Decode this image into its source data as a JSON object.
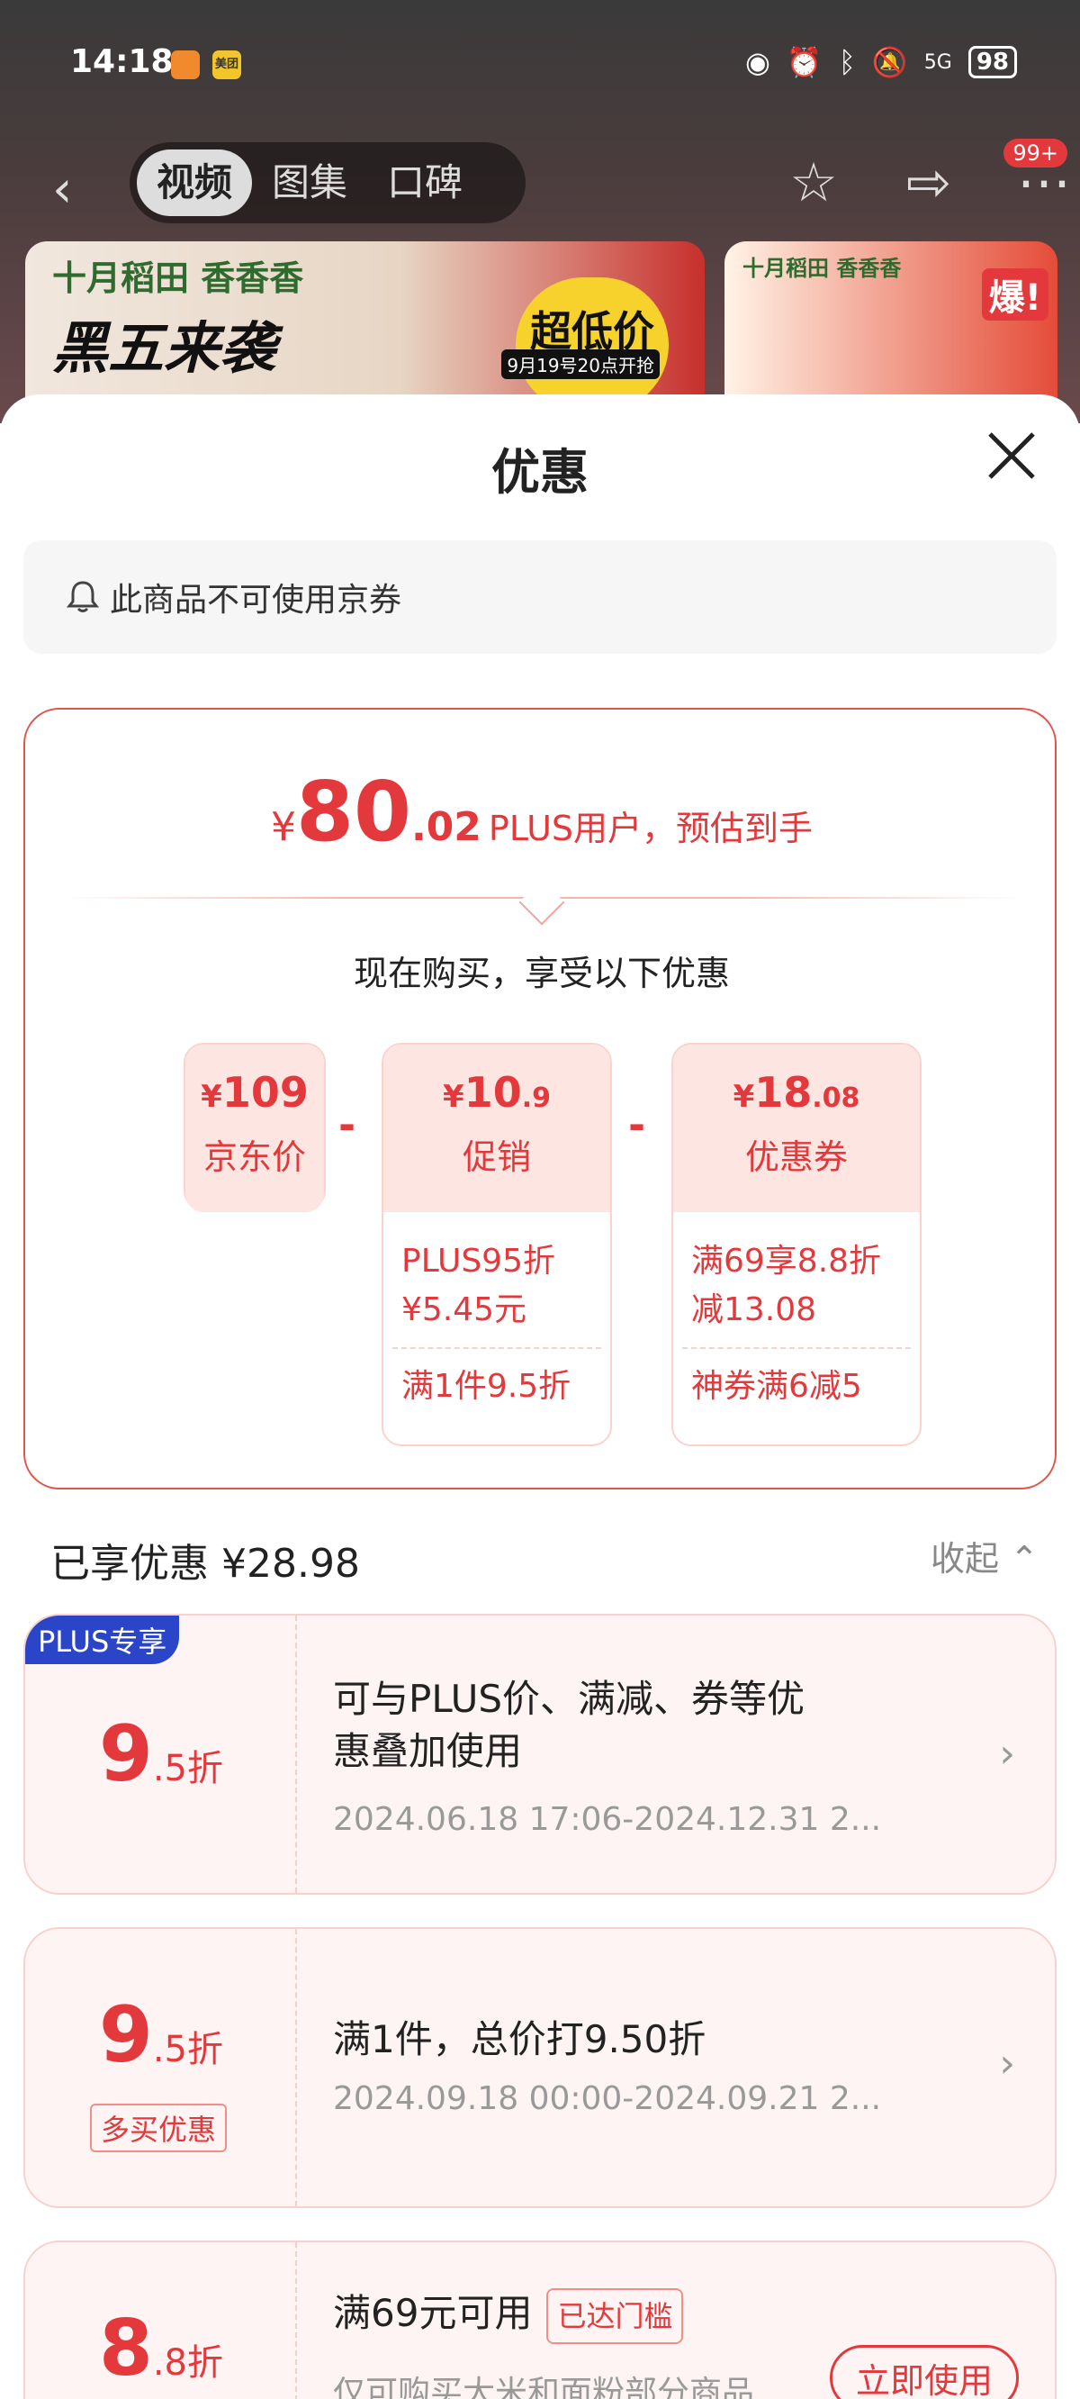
{
  "status_bar": {
    "time": "14:18",
    "app_badge": "美团",
    "battery": "98",
    "network": "5G"
  },
  "nav": {
    "tabs": [
      "视频",
      "图集",
      "口碑"
    ],
    "active_tab": 0,
    "cart_badge": "99+"
  },
  "ads": {
    "brand": "十月稻田 香香香",
    "slogan": "黑五来袭",
    "promo": "超低价",
    "promo_date": "9月19号20点开抢",
    "side_brand": "十月稻田 香香香",
    "side_tag": "爆!"
  },
  "sheet": {
    "title": "优惠",
    "notice": "此商品不可使用京券"
  },
  "price": {
    "symbol": "¥",
    "integer": "80",
    "decimal": ".02",
    "label": "PLUS用户，预估到手",
    "now_buy": "现在购买，享受以下优惠",
    "jd_price": {
      "symbol": "¥",
      "amount": "109",
      "label": "京东价"
    },
    "promotion": {
      "symbol": "¥",
      "int": "10",
      "dec": ".9",
      "label": "促销",
      "detail_line1": "PLUS95折",
      "detail_line2": "¥5.45元",
      "detail2": "满1件9.5折"
    },
    "coupon": {
      "symbol": "¥",
      "int": "18",
      "dec": ".08",
      "label": "优惠券",
      "detail_line1": "满69享8.8折",
      "detail_line2": "减13.08",
      "detail2": "神券满6减5"
    },
    "minus": "-"
  },
  "enjoyed": {
    "label": "已享优惠 ¥28.98",
    "collapse": "收起"
  },
  "coupons": [
    {
      "tag": "PLUS专享",
      "int": "9",
      "dec": ".5折",
      "title_line1": "可与PLUS价、满减、券等优",
      "title_line2": "惠叠加使用",
      "sub": "2024.06.18 17:06-2024.12.31 2..."
    },
    {
      "tag": "多买优惠",
      "int": "9",
      "dec": ".5折",
      "title_line1": "满1件，总价打9.50折",
      "sub": "2024.09.18 00:00-2024.09.21 2..."
    },
    {
      "int": "8",
      "dec": ".8折",
      "title_line1": "满69元可用",
      "reach": "已达门槛",
      "sub": "仅可购买大米和面粉部分商品",
      "button": "立即使用"
    }
  ],
  "colors": {
    "accent": "#e4393c",
    "plus_badge": "#2b45c8"
  }
}
